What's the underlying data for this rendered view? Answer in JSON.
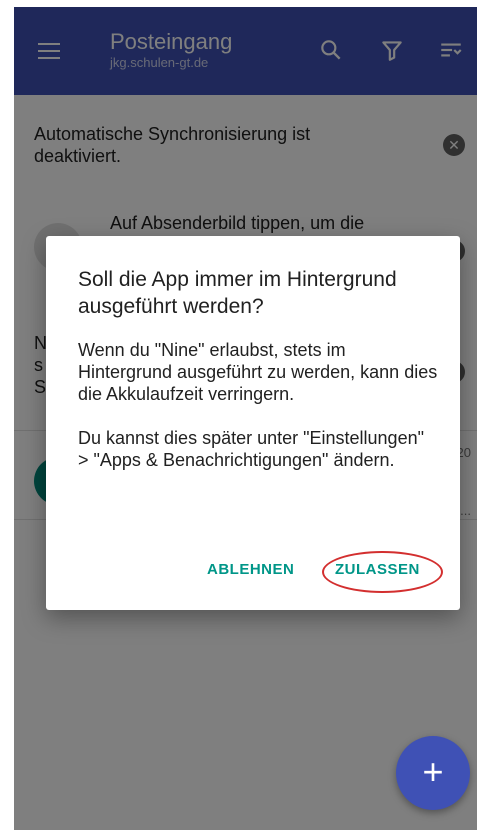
{
  "appbar": {
    "title": "Posteingang",
    "account": "jkg.schulen-gt.de",
    "icons": [
      "menu-icon",
      "search-icon",
      "filter-icon",
      "sort-icon"
    ]
  },
  "banners": {
    "sync_text": "Automatische Synchronisierung ist deaktiviert.",
    "tip_text": "Auf Absenderbild tippen, um die",
    "dismiss_glyph": "✕",
    "fragment_letters": [
      "N",
      "s",
      "S"
    ]
  },
  "mail": {
    "time_fragment": "20",
    "ellipsis": "..."
  },
  "dialog": {
    "title": "Soll die App immer im Hintergrund ausgeführt werden?",
    "paragraph1": "Wenn du \"Nine\" erlaubst, stets im Hintergrund ausgeführt zu werden, kann dies die  Akkulaufzeit verringern.",
    "paragraph2": "Du kannst dies später unter \"Einstellungen\" > \"Apps & Benachrichtigungen\" ändern.",
    "deny_label": "ABLEHNEN",
    "allow_label": "ZULASSEN"
  },
  "fab": {
    "glyph": "+"
  },
  "colors": {
    "primary": "#3f51b5",
    "accent": "#009688",
    "highlight": "#d32f2f"
  }
}
